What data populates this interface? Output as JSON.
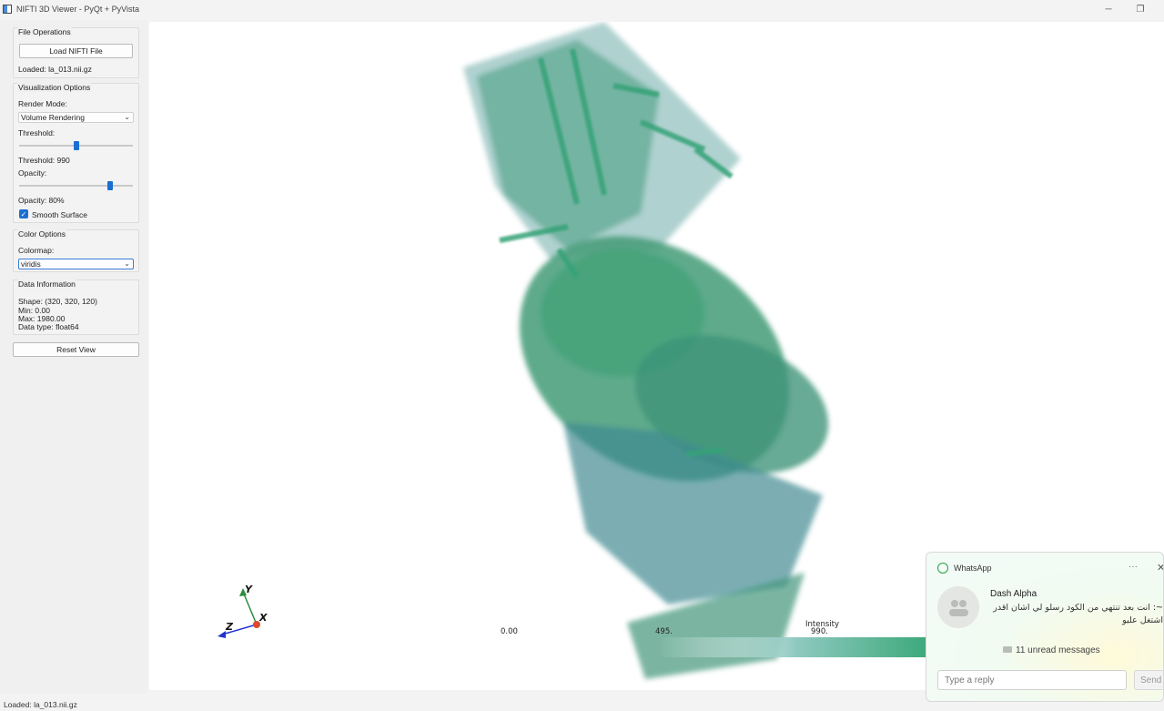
{
  "window": {
    "title": "NIFTI 3D Viewer - PyQt + PyVista",
    "minimize_glyph": "─",
    "maximize_glyph": "❐"
  },
  "file_ops": {
    "title": "File Operations",
    "load_button": "Load NIFTI File",
    "loaded_text": "Loaded: la_013.nii.gz"
  },
  "viz": {
    "title": "Visualization Options",
    "render_mode_label": "Render Mode:",
    "render_mode_value": "Volume Rendering",
    "threshold_label": "Threshold:",
    "threshold_value_text": "Threshold: 990",
    "threshold_level": 0.5,
    "opacity_label": "Opacity:",
    "opacity_value_text": "Opacity: 80%",
    "opacity_level": 0.8,
    "smooth_label": "Smooth Surface",
    "smooth_checked": true
  },
  "color": {
    "title": "Color Options",
    "colormap_label": "Colormap:",
    "colormap_value": "viridis"
  },
  "data_info": {
    "title": "Data Information",
    "shape": "Shape: (320, 320, 120)",
    "min": "Min: 0.00",
    "max": "Max: 1980.00",
    "dtype": "Data type: float64"
  },
  "reset_button": "Reset View",
  "viewport": {
    "axes": {
      "x": "X",
      "y": "Y",
      "z": "Z"
    },
    "scalar_bar": {
      "title": "Intensity",
      "ticks": [
        "0.00",
        "495.",
        "990."
      ]
    }
  },
  "statusbar": "Loaded: la_013.nii.gz",
  "notification": {
    "app": "WhatsApp",
    "more_glyph": "···",
    "close_glyph": "✕",
    "sender": "Dash Alpha",
    "message": "~: انت بعد تنتهي من الكود رسلو لي اشان اقدر اشتغل عليو",
    "unread": "11 unread messages",
    "reply_placeholder": "Type a reply",
    "send_label": "Send"
  },
  "colors": {
    "accent": "#1b6fd1",
    "volume_green": "#2f9a6a",
    "volume_teal": "#2c7f86"
  }
}
